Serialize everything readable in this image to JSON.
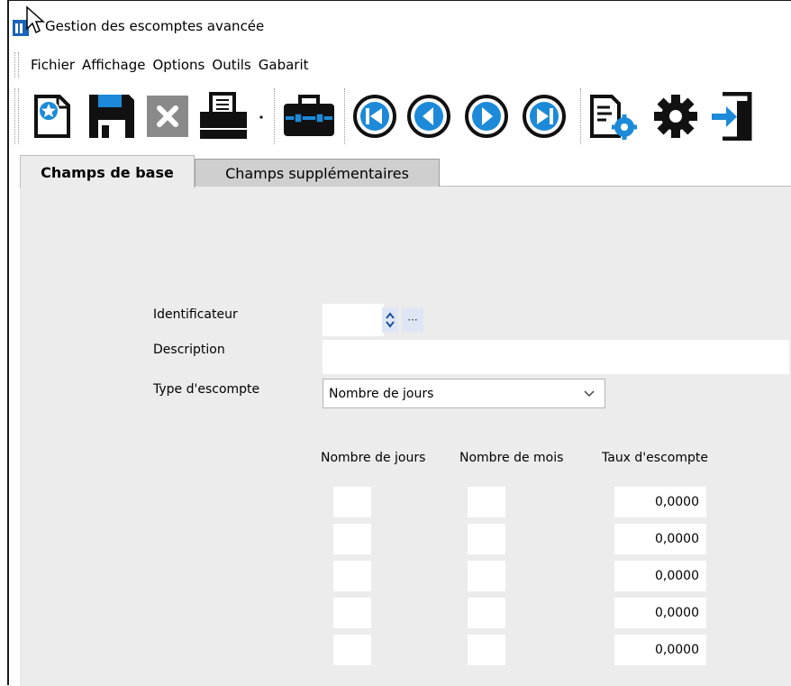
{
  "window": {
    "title": "Gestion des escomptes avancée"
  },
  "menu": [
    "Fichier",
    "Affichage",
    "Options",
    "Outils",
    "Gabarit"
  ],
  "toolbar": [
    {
      "name": "new-record-icon"
    },
    {
      "name": "save-icon"
    },
    {
      "name": "delete-icon"
    },
    {
      "name": "print-icon"
    },
    {
      "name": "briefcase-icon"
    },
    {
      "name": "first-record-icon"
    },
    {
      "name": "previous-record-icon"
    },
    {
      "name": "next-record-icon"
    },
    {
      "name": "last-record-icon"
    },
    {
      "name": "report-settings-icon"
    },
    {
      "name": "gear-icon"
    },
    {
      "name": "exit-icon"
    }
  ],
  "tabs": {
    "active": "Champs de base",
    "other": "Champs supplémentaires"
  },
  "form": {
    "identifier_label": "Identificateur",
    "identifier_value": "",
    "description_label": "Description",
    "description_value": "",
    "type_label": "Type d'escompte",
    "type_value": "Nombre de jours"
  },
  "grid": {
    "headers": [
      "Nombre de jours",
      "Nombre de mois",
      "Taux d'escompte"
    ],
    "rows": [
      {
        "days": "",
        "months": "",
        "rate": "0,0000"
      },
      {
        "days": "",
        "months": "",
        "rate": "0,0000"
      },
      {
        "days": "",
        "months": "",
        "rate": "0,0000"
      },
      {
        "days": "",
        "months": "",
        "rate": "0,0000"
      },
      {
        "days": "",
        "months": "",
        "rate": "0,0000"
      }
    ]
  },
  "colors": {
    "icon_dark": "#111111",
    "icon_blue": "#1c8ad8",
    "tab_panel": "#ececec"
  }
}
